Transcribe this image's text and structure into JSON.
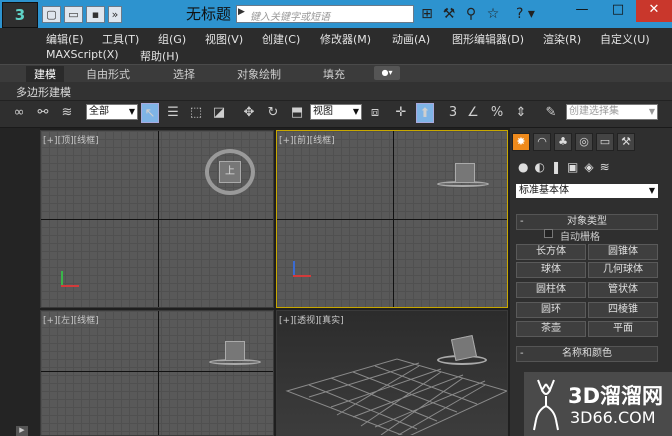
{
  "titlebar": {
    "title": "无标题",
    "search_placeholder": "键入关键字或短语",
    "help": "?",
    "help_caret": "▾",
    "min": "—",
    "max": "□",
    "close": "✕"
  },
  "menus": {
    "row1": [
      "编辑(E)",
      "工具(T)",
      "组(G)",
      "视图(V)",
      "创建(C)",
      "修改器(M)",
      "动画(A)",
      "图形编辑器(D)",
      "渲染(R)",
      "自定义(U)"
    ],
    "row2": [
      "MAXScript(X)",
      "帮助(H)"
    ]
  },
  "ribbon": {
    "tabs": [
      "建模",
      "自由形式",
      "选择",
      "对象绘制",
      "填充"
    ],
    "sub": "多边形建模"
  },
  "toolbar": {
    "filter": "全部",
    "view": "视图",
    "snap_left": "3",
    "snap_pct": "%",
    "selset": "创建选择集"
  },
  "viewports": {
    "top": "[+][顶][线框]",
    "front": "[+][前][线框]",
    "left": "[+][左][线框]",
    "persp": "[+][透视][真实]",
    "cube_top": "上"
  },
  "panel": {
    "category": "标准基本体",
    "rollout_type": "对象类型",
    "autogrid": "自动栅格",
    "buttons": [
      "长方体",
      "圆锥体",
      "球体",
      "几何球体",
      "圆柱体",
      "管状体",
      "圆环",
      "四棱锥",
      "茶壶",
      "平面"
    ],
    "rollout_name": "名称和颜色"
  },
  "watermark": {
    "brand": "3D溜溜网",
    "url": "3D66.COM"
  }
}
